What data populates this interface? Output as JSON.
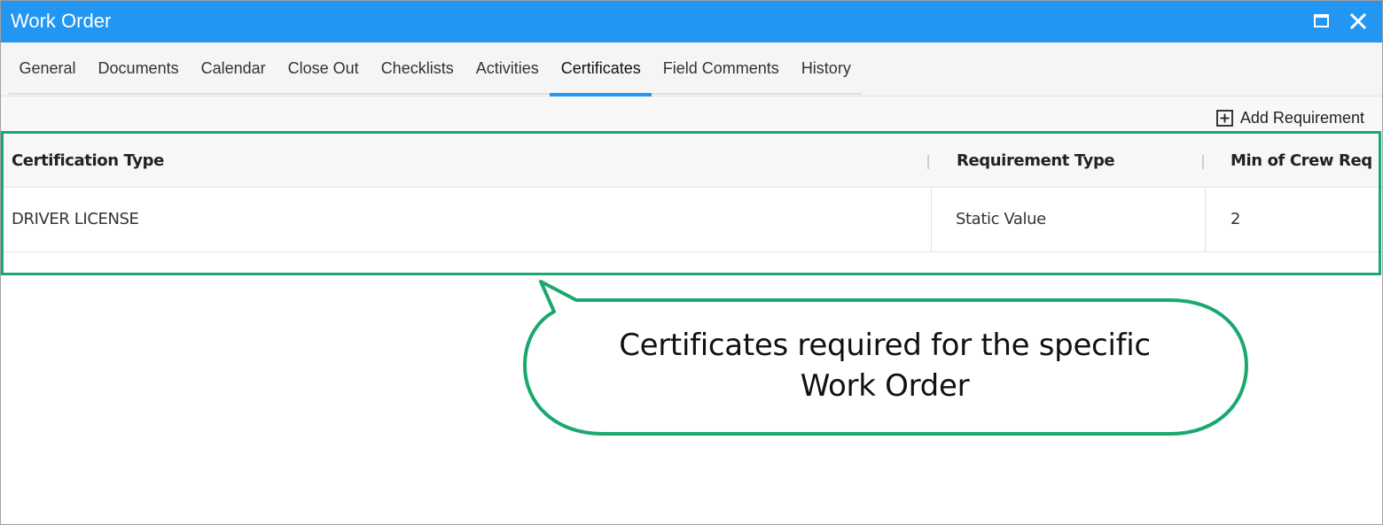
{
  "window": {
    "title": "Work Order",
    "titlebar_color": "#2196f3",
    "controls": [
      "maximize-icon",
      "close-icon"
    ]
  },
  "tabs": [
    {
      "label": "General"
    },
    {
      "label": "Documents"
    },
    {
      "label": "Calendar"
    },
    {
      "label": "Close Out"
    },
    {
      "label": "Checklists"
    },
    {
      "label": "Activities"
    },
    {
      "label": "Certificates",
      "active": true
    },
    {
      "label": "Field Comments"
    },
    {
      "label": "History"
    }
  ],
  "toolbar": {
    "add_requirement_label": "Add Requirement",
    "add_requirement_icon": "plus-square-icon"
  },
  "grid": {
    "columns": [
      "Certification Type",
      "Requirement Type",
      "Min of Crew Req"
    ],
    "rows": [
      [
        "DRIVER LICENSE",
        "Static Value",
        "2"
      ]
    ]
  },
  "annotation": {
    "text_line1": "Certificates required for the specific",
    "text_line2": "Work Order",
    "accent_color": "#1aa86e"
  }
}
